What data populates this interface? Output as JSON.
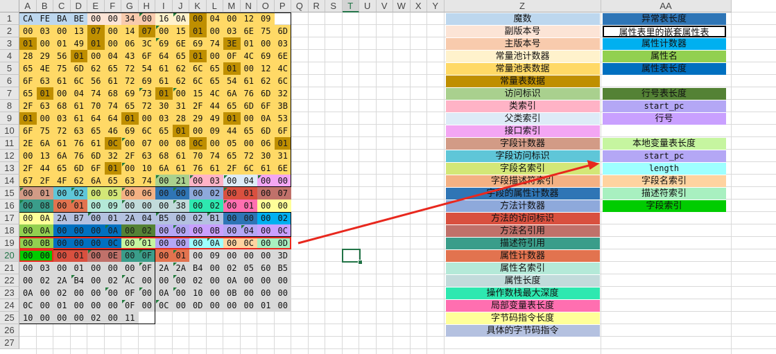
{
  "columns": [
    "A",
    "B",
    "C",
    "D",
    "E",
    "F",
    "G",
    "H",
    "I",
    "J",
    "K",
    "L",
    "M",
    "N",
    "O",
    "P",
    "Q",
    "R",
    "S",
    "T",
    "U",
    "V",
    "W",
    "X",
    "Y",
    "Z",
    "AA"
  ],
  "rows": [
    "1",
    "2",
    "3",
    "4",
    "5",
    "6",
    "7",
    "8",
    "9",
    "10",
    "11",
    "12",
    "13",
    "14",
    "15",
    "16",
    "17",
    "18",
    "19",
    "20",
    "21",
    "22",
    "23",
    "24",
    "25",
    "26",
    "27"
  ],
  "selected_cell": "T20",
  "hex_rows": [
    [
      "CA",
      "FE",
      "BA",
      "BE",
      "00",
      "00",
      "34",
      "00",
      "16",
      "0A",
      "00",
      "04",
      "00",
      "12",
      "09"
    ],
    [
      "00",
      "03",
      "00",
      "13",
      "07",
      "00",
      "14",
      "07",
      "00",
      "15",
      "01",
      "00",
      "03",
      "6E",
      "75",
      "6D"
    ],
    [
      "01",
      "00",
      "01",
      "49",
      "01",
      "00",
      "06",
      "3C",
      "69",
      "6E",
      "69",
      "74",
      "3E",
      "01",
      "00",
      "03"
    ],
    [
      "28",
      "29",
      "56",
      "01",
      "00",
      "04",
      "43",
      "6F",
      "64",
      "65",
      "01",
      "00",
      "0F",
      "4C",
      "69",
      "6E"
    ],
    [
      "65",
      "4E",
      "75",
      "6D",
      "62",
      "65",
      "72",
      "54",
      "61",
      "62",
      "6C",
      "65",
      "01",
      "00",
      "12",
      "4C"
    ],
    [
      "6F",
      "63",
      "61",
      "6C",
      "56",
      "61",
      "72",
      "69",
      "61",
      "62",
      "6C",
      "65",
      "54",
      "61",
      "62",
      "6C"
    ],
    [
      "65",
      "01",
      "00",
      "04",
      "74",
      "68",
      "69",
      "73",
      "01",
      "00",
      "15",
      "4C",
      "6A",
      "76",
      "6D",
      "32"
    ],
    [
      "2F",
      "63",
      "68",
      "61",
      "70",
      "74",
      "65",
      "72",
      "30",
      "31",
      "2F",
      "44",
      "65",
      "6D",
      "6F",
      "3B"
    ],
    [
      "01",
      "00",
      "03",
      "61",
      "64",
      "64",
      "01",
      "00",
      "03",
      "28",
      "29",
      "49",
      "01",
      "00",
      "0A",
      "53"
    ],
    [
      "6F",
      "75",
      "72",
      "63",
      "65",
      "46",
      "69",
      "6C",
      "65",
      "01",
      "00",
      "09",
      "44",
      "65",
      "6D",
      "6F"
    ],
    [
      "2E",
      "6A",
      "61",
      "76",
      "61",
      "0C",
      "00",
      "07",
      "00",
      "08",
      "0C",
      "00",
      "05",
      "00",
      "06",
      "01"
    ],
    [
      "00",
      "13",
      "6A",
      "76",
      "6D",
      "32",
      "2F",
      "63",
      "68",
      "61",
      "70",
      "74",
      "65",
      "72",
      "30",
      "31"
    ],
    [
      "2F",
      "44",
      "65",
      "6D",
      "6F",
      "01",
      "00",
      "10",
      "6A",
      "61",
      "76",
      "61",
      "2F",
      "6C",
      "61",
      "6E"
    ],
    [
      "67",
      "2F",
      "4F",
      "62",
      "6A",
      "65",
      "63",
      "74",
      "00",
      "21",
      "00",
      "03",
      "00",
      "04",
      "00",
      "00"
    ],
    [
      "00",
      "01",
      "00",
      "02",
      "00",
      "05",
      "00",
      "06",
      "00",
      "00",
      "00",
      "02",
      "00",
      "01",
      "00",
      "07"
    ],
    [
      "00",
      "08",
      "00",
      "01",
      "00",
      "09",
      "00",
      "00",
      "00",
      "38",
      "00",
      "02",
      "00",
      "01",
      "00",
      "00"
    ],
    [
      "00",
      "0A",
      "2A",
      "B7",
      "00",
      "01",
      "2A",
      "04",
      "B5",
      "00",
      "02",
      "B1",
      "00",
      "00",
      "00",
      "02"
    ],
    [
      "00",
      "0A",
      "00",
      "00",
      "00",
      "0A",
      "00",
      "02",
      "00",
      "00",
      "00",
      "0B",
      "00",
      "04",
      "00",
      "0C"
    ],
    [
      "00",
      "0B",
      "00",
      "00",
      "00",
      "0C",
      "00",
      "01",
      "00",
      "00",
      "00",
      "0A",
      "00",
      "0C",
      "00",
      "0D"
    ],
    [
      "00",
      "00",
      "00",
      "01",
      "00",
      "0E",
      "00",
      "0F",
      "00",
      "01",
      "00",
      "09",
      "00",
      "00",
      "00",
      "3D"
    ],
    [
      "00",
      "03",
      "00",
      "01",
      "00",
      "00",
      "00",
      "0F",
      "2A",
      "2A",
      "B4",
      "00",
      "02",
      "05",
      "60",
      "B5"
    ],
    [
      "00",
      "02",
      "2A",
      "B4",
      "00",
      "02",
      "AC",
      "00",
      "00",
      "00",
      "02",
      "00",
      "0A",
      "00",
      "00",
      "00"
    ],
    [
      "0A",
      "00",
      "02",
      "00",
      "00",
      "00",
      "0F",
      "00",
      "0A",
      "00",
      "10",
      "00",
      "0B",
      "00",
      "00",
      "00"
    ],
    [
      "0C",
      "00",
      "01",
      "00",
      "00",
      "00",
      "0F",
      "00",
      "0C",
      "00",
      "0D",
      "00",
      "00",
      "00",
      "01",
      "00"
    ],
    [
      "10",
      "00",
      "00",
      "00",
      "02",
      "00",
      "11"
    ]
  ],
  "legend_z": [
    "魔数",
    "副版本号",
    "主版本号",
    "常量池计数器",
    "常量池表数据",
    "常量表数据",
    "访问标识",
    "类索引",
    "父类索引",
    "接口索引",
    "字段计数器",
    "字段访问标识",
    "字段名索引",
    "字段描述符索引",
    "字段的属性计数器",
    "方法计数器",
    "方法的访问标识",
    "方法名引用",
    "描述符引用",
    "属性计数器",
    "属性名索引",
    "属性长度",
    "操作数栈最大深度",
    "局部变量表长度",
    "字节码指令长度",
    "具体的字节码指令"
  ],
  "legend_aa": [
    "异常表长度",
    "属性表里的嵌套属性表",
    "属性计数器",
    "属性名",
    "属性表长度",
    "",
    "行号表长度",
    "start_pc",
    "行号",
    "",
    "本地变量表长度",
    "start_pc",
    "length",
    "字段名索引",
    "描述符索引",
    "字段索引"
  ],
  "colors": {
    "grid": "#d9d9d9",
    "header_bg": "#e6e6e6",
    "excel_green": "#217346",
    "arrow": "#e8281e",
    "magic": "#bdd7ee",
    "minor": "#fce4d6",
    "major": "#f8cbad",
    "cp_count": "#fff2cc",
    "cp_data": "#ffd966",
    "const_table": "#bf8f00",
    "access": "#a9d08e",
    "this_class": "#ffb3c6",
    "super_class": "#ddebf7",
    "interfaces": "#f3a6f3",
    "field_count": "#d29b86",
    "field_access": "#5fc6d8",
    "field_name": "#d3e777",
    "field_desc": "#f4b183",
    "field_attr_count": "#2f75b5",
    "method_count": "#8ea9db",
    "method_access": "#d9503f",
    "method_name": "#c0716a",
    "method_desc": "#3a9d8a",
    "attr_count": "#e2734f",
    "attr_name_idx": "#b4e9d8",
    "attr_len": "#c2dbdb",
    "max_stack": "#2ee8b0",
    "max_locals": "#ff6fb0",
    "code_len": "#ffff99",
    "code": "#b4c1e0",
    "code_region": "#d9d9d9",
    "ex_table_len": "#2e75b6",
    "nested_attr": "#ffffff",
    "aa_attr_count": "#00b0f0",
    "aa_attr_name": "#92d050",
    "aa_attr_len": "#0070c0",
    "line_table_len": "#548235",
    "start_pc": "#b4a7f5",
    "line_no": "#c9a0ff",
    "local_var_len": "#c6f5a0",
    "lv_start_pc": "#b4a7f5",
    "lv_length": "#9effff",
    "lv_name": "#ffd3a0",
    "lv_desc": "#a8f0c0",
    "lv_index": "#00cc00"
  }
}
